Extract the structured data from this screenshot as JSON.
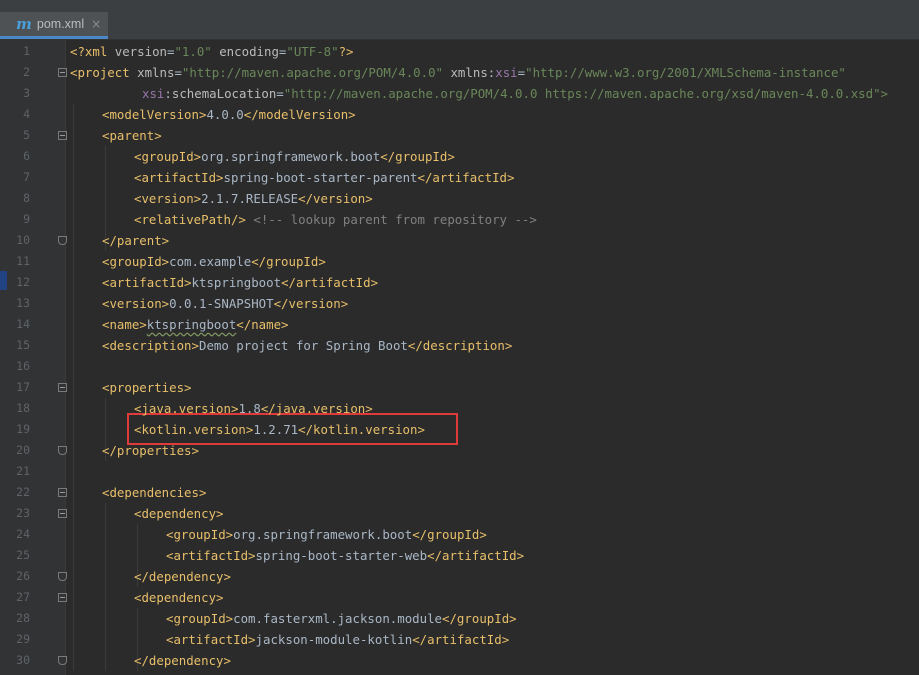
{
  "tab": {
    "icon": "maven-m-icon",
    "icon_glyph": "m",
    "title": "pom.xml",
    "close_glyph": "×"
  },
  "lines": [
    {
      "n": "1",
      "indent": 0,
      "tokens": [
        [
          "t",
          "<?xml "
        ],
        [
          "a",
          "version"
        ],
        [
          "x",
          "="
        ],
        [
          "v",
          "\"1.0\""
        ],
        [
          "a",
          " encoding"
        ],
        [
          "x",
          "="
        ],
        [
          "v",
          "\"UTF-8\""
        ],
        [
          "t",
          "?>"
        ]
      ]
    },
    {
      "n": "2",
      "indent": 0,
      "tokens": [
        [
          "t",
          "<project "
        ],
        [
          "a",
          "xmlns"
        ],
        [
          "x",
          "="
        ],
        [
          "v",
          "\"http://maven.apache.org/POM/4.0.0\""
        ],
        [
          "a",
          " xmlns"
        ],
        [
          "x",
          ":"
        ],
        [
          "n",
          "xsi"
        ],
        [
          "x",
          "="
        ],
        [
          "v",
          "\"http://www.w3.org/2001/XMLSchema-instance\""
        ]
      ]
    },
    {
      "n": "3",
      "indent": 9,
      "tokens": [
        [
          "n",
          "xsi"
        ],
        [
          "x",
          ":"
        ],
        [
          "a",
          "schemaLocation"
        ],
        [
          "x",
          "="
        ],
        [
          "v",
          "\"http://maven.apache.org/POM/4.0.0 https://maven.apache.org/xsd/maven-4.0.0.xsd\">"
        ]
      ]
    },
    {
      "n": "4",
      "indent": 4,
      "tokens": [
        [
          "t",
          "<modelVersion>"
        ],
        [
          "x",
          "4.0.0"
        ],
        [
          "t",
          "</modelVersion>"
        ]
      ]
    },
    {
      "n": "5",
      "indent": 4,
      "tokens": [
        [
          "t",
          "<parent>"
        ]
      ]
    },
    {
      "n": "6",
      "indent": 8,
      "tokens": [
        [
          "t",
          "<groupId>"
        ],
        [
          "x",
          "org.springframework.boot"
        ],
        [
          "t",
          "</groupId>"
        ]
      ]
    },
    {
      "n": "7",
      "indent": 8,
      "tokens": [
        [
          "t",
          "<artifactId>"
        ],
        [
          "x",
          "spring-boot-starter-parent"
        ],
        [
          "t",
          "</artifactId>"
        ]
      ]
    },
    {
      "n": "8",
      "indent": 8,
      "tokens": [
        [
          "t",
          "<version>"
        ],
        [
          "x",
          "2.1.7.RELEASE"
        ],
        [
          "t",
          "</version>"
        ]
      ]
    },
    {
      "n": "9",
      "indent": 8,
      "tokens": [
        [
          "t",
          "<relativePath/>"
        ],
        [
          "x",
          " "
        ],
        [
          "c",
          "<!-- lookup parent from repository -->"
        ]
      ]
    },
    {
      "n": "10",
      "indent": 4,
      "tokens": [
        [
          "t",
          "</parent>"
        ]
      ]
    },
    {
      "n": "11",
      "indent": 4,
      "tokens": [
        [
          "t",
          "<groupId>"
        ],
        [
          "x",
          "com.example"
        ],
        [
          "t",
          "</groupId>"
        ]
      ]
    },
    {
      "n": "12",
      "indent": 4,
      "tokens": [
        [
          "t",
          "<artifactId>"
        ],
        [
          "x",
          "ktspringboot"
        ],
        [
          "t",
          "</artifactId>"
        ]
      ]
    },
    {
      "n": "13",
      "indent": 4,
      "tokens": [
        [
          "t",
          "<version>"
        ],
        [
          "x",
          "0.0.1-SNAPSHOT"
        ],
        [
          "t",
          "</version>"
        ]
      ]
    },
    {
      "n": "14",
      "indent": 4,
      "tokens": [
        [
          "t",
          "<name>"
        ],
        [
          "xw",
          "ktspringboot"
        ],
        [
          "t",
          "</name>"
        ]
      ]
    },
    {
      "n": "15",
      "indent": 4,
      "tokens": [
        [
          "t",
          "<description>"
        ],
        [
          "x",
          "Demo project for Spring Boot"
        ],
        [
          "t",
          "</description>"
        ]
      ]
    },
    {
      "n": "16",
      "indent": 0,
      "tokens": []
    },
    {
      "n": "17",
      "indent": 4,
      "tokens": [
        [
          "t",
          "<properties>"
        ]
      ]
    },
    {
      "n": "18",
      "indent": 8,
      "tokens": [
        [
          "t",
          "<java.version>"
        ],
        [
          "x",
          "1.8"
        ],
        [
          "t",
          "</java.version>"
        ]
      ]
    },
    {
      "n": "19",
      "indent": 8,
      "tokens": [
        [
          "t",
          "<kotlin.version>"
        ],
        [
          "x",
          "1.2.71"
        ],
        [
          "t",
          "</kotlin.version>"
        ]
      ]
    },
    {
      "n": "20",
      "indent": 4,
      "tokens": [
        [
          "t",
          "</properties>"
        ]
      ]
    },
    {
      "n": "21",
      "indent": 0,
      "tokens": []
    },
    {
      "n": "22",
      "indent": 4,
      "tokens": [
        [
          "t",
          "<dependencies>"
        ]
      ]
    },
    {
      "n": "23",
      "indent": 8,
      "tokens": [
        [
          "t",
          "<dependency>"
        ]
      ]
    },
    {
      "n": "24",
      "indent": 12,
      "tokens": [
        [
          "t",
          "<groupId>"
        ],
        [
          "x",
          "org.springframework.boot"
        ],
        [
          "t",
          "</groupId>"
        ]
      ]
    },
    {
      "n": "25",
      "indent": 12,
      "tokens": [
        [
          "t",
          "<artifactId>"
        ],
        [
          "x",
          "spring-boot-starter-web"
        ],
        [
          "t",
          "</artifactId>"
        ]
      ]
    },
    {
      "n": "26",
      "indent": 8,
      "tokens": [
        [
          "t",
          "</dependency>"
        ]
      ]
    },
    {
      "n": "27",
      "indent": 8,
      "tokens": [
        [
          "t",
          "<dependency>"
        ]
      ]
    },
    {
      "n": "28",
      "indent": 12,
      "tokens": [
        [
          "t",
          "<groupId>"
        ],
        [
          "x",
          "com.fasterxml.jackson.module"
        ],
        [
          "t",
          "</groupId>"
        ]
      ]
    },
    {
      "n": "29",
      "indent": 12,
      "tokens": [
        [
          "t",
          "<artifactId>"
        ],
        [
          "x",
          "jackson-module-kotlin"
        ],
        [
          "t",
          "</artifactId>"
        ]
      ]
    },
    {
      "n": "30",
      "indent": 8,
      "tokens": [
        [
          "t",
          "</dependency>"
        ]
      ]
    }
  ],
  "folds": [
    {
      "line": 2,
      "kind": "open"
    },
    {
      "line": 5,
      "kind": "open"
    },
    {
      "line": 10,
      "kind": "end"
    },
    {
      "line": 17,
      "kind": "open"
    },
    {
      "line": 20,
      "kind": "end"
    },
    {
      "line": 22,
      "kind": "open"
    },
    {
      "line": 23,
      "kind": "open"
    },
    {
      "line": 26,
      "kind": "end"
    },
    {
      "line": 27,
      "kind": "open"
    },
    {
      "line": 30,
      "kind": "end"
    }
  ],
  "highlight": {
    "line": 19,
    "color": "#e03b3b"
  },
  "colors": {
    "tag": "#e8bf6a",
    "attribute": "#bababa",
    "namespace": "#9876aa",
    "string": "#6a8759",
    "text": "#a9b7c6",
    "comment": "#808080",
    "background": "#2b2b2b"
  }
}
